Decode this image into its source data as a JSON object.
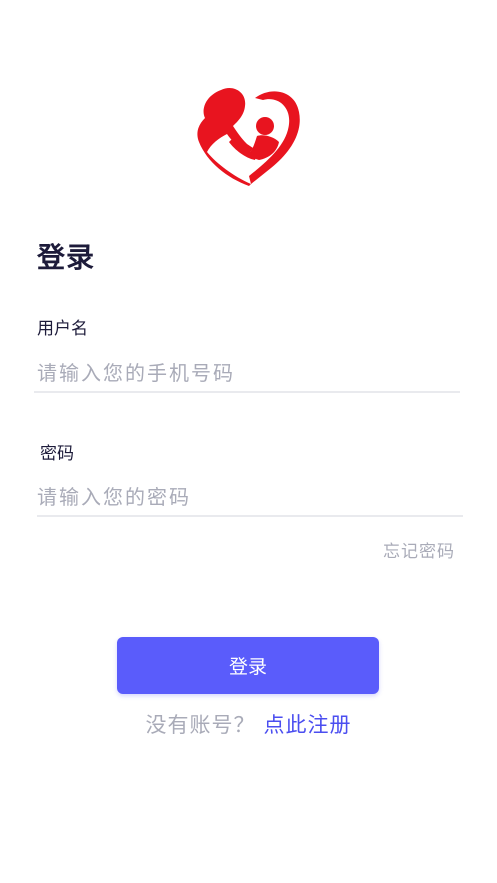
{
  "logo": {
    "icon": "mother-child-heart-logo",
    "color": "#e8141f"
  },
  "page_title": "登录",
  "username": {
    "label": "用户名",
    "value": "",
    "placeholder": "请输入您的手机号码"
  },
  "password": {
    "label": "密码",
    "value": "",
    "placeholder": "请输入您的密码"
  },
  "forgot_password": "忘记密码",
  "login_button": "登录",
  "register": {
    "prompt": "没有账号？",
    "link": "点此注册"
  },
  "colors": {
    "accent": "#5a5cfb",
    "link": "#4b4ef0",
    "title": "#1d1b3a",
    "placeholder": "#a9abb8"
  }
}
